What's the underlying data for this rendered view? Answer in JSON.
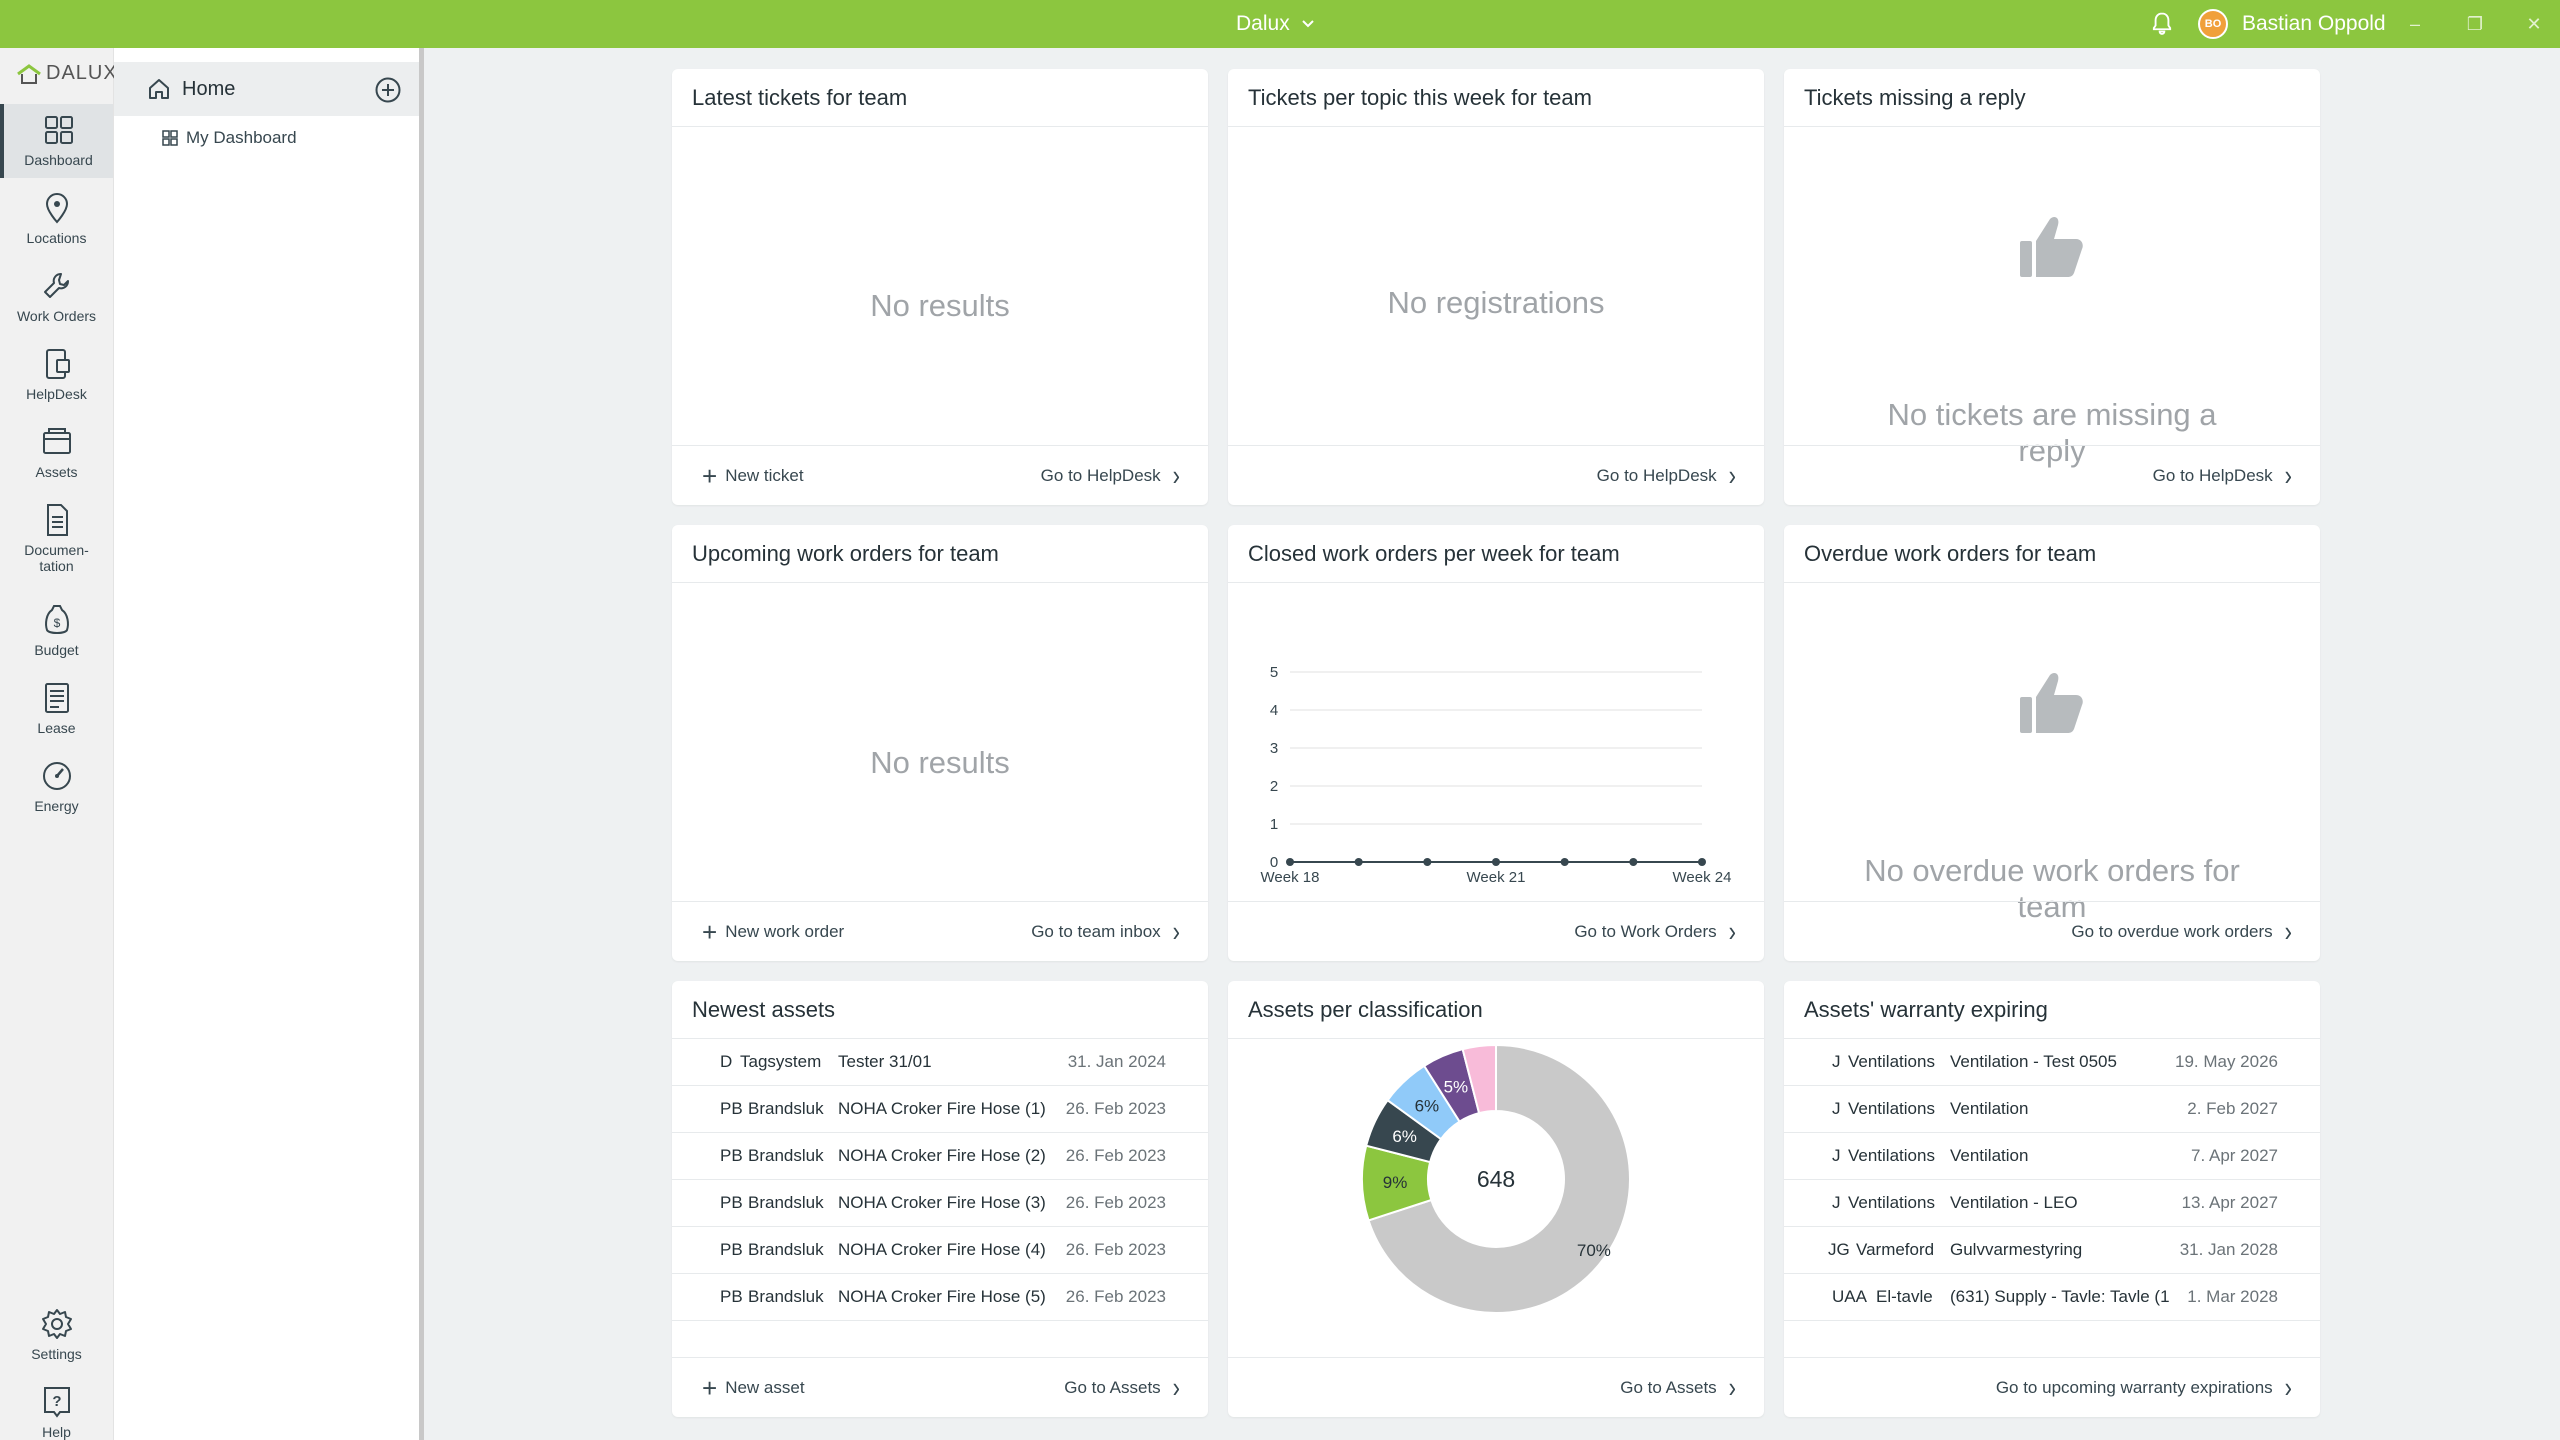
{
  "titlebar": {
    "app_title": "Dalux",
    "user_initials": "BO",
    "user_name": "Bastian Oppold"
  },
  "rail": {
    "logo_text": "DALUX",
    "items": [
      {
        "label": "Dashboard"
      },
      {
        "label": "Locations"
      },
      {
        "label": "Work Orders"
      },
      {
        "label": "HelpDesk"
      },
      {
        "label": "Assets"
      },
      {
        "label": "Documen-\ntation"
      },
      {
        "label": "Budget"
      },
      {
        "label": "Lease"
      },
      {
        "label": "Energy"
      },
      {
        "label": "Settings"
      },
      {
        "label": "Help"
      }
    ]
  },
  "nav": {
    "home_label": "Home",
    "dashboard_link": "My Dashboard"
  },
  "cards": {
    "latest_tickets": {
      "title": "Latest tickets for team",
      "empty": "No results",
      "new_label": "New ticket",
      "go_label": "Go to HelpDesk"
    },
    "tickets_topic": {
      "title": "Tickets per topic this week for team",
      "empty": "No registrations",
      "go_label": "Go to HelpDesk"
    },
    "missing_reply": {
      "title": "Tickets missing a reply",
      "empty_line1": "No tickets are missing a",
      "empty_line2": "reply",
      "go_label": "Go to HelpDesk"
    },
    "upcoming_wo": {
      "title": "Upcoming work orders for team",
      "empty": "No results",
      "new_label": "New work order",
      "go_label": "Go to team inbox"
    },
    "closed_wo": {
      "title": "Closed work orders per week for team",
      "go_label": "Go to Work Orders"
    },
    "overdue_wo": {
      "title": "Overdue work orders for team",
      "empty_line1": "No overdue work orders for",
      "empty_line2": "team",
      "go_label": "Go to overdue work orders"
    },
    "newest_assets": {
      "title": "Newest assets",
      "rows": [
        {
          "code": "D",
          "category": "Tagsystem",
          "name": "Tester 31/01",
          "date": "31. Jan 2024"
        },
        {
          "code": "PB",
          "category": "Brandsluk",
          "name": "NOHA Croker Fire Hose (1)",
          "date": "26. Feb 2023"
        },
        {
          "code": "PB",
          "category": "Brandsluk",
          "name": "NOHA Croker Fire Hose (2)",
          "date": "26. Feb 2023"
        },
        {
          "code": "PB",
          "category": "Brandsluk",
          "name": "NOHA Croker Fire Hose (3)",
          "date": "26. Feb 2023"
        },
        {
          "code": "PB",
          "category": "Brandsluk",
          "name": "NOHA Croker Fire Hose (4)",
          "date": "26. Feb 2023"
        },
        {
          "code": "PB",
          "category": "Brandsluk",
          "name": "NOHA Croker Fire Hose (5)",
          "date": "26. Feb 2023"
        }
      ],
      "new_label": "New asset",
      "go_label": "Go to Assets"
    },
    "assets_class": {
      "title": "Assets per classification",
      "go_label": "Go to Assets"
    },
    "warranty": {
      "title": "Assets' warranty expiring",
      "rows": [
        {
          "code": "J",
          "category": "Ventilations",
          "name": "Ventilation - Test 0505",
          "date": "19. May 2026"
        },
        {
          "code": "J",
          "category": "Ventilations",
          "name": "Ventilation",
          "date": "2. Feb 2027"
        },
        {
          "code": "J",
          "category": "Ventilations",
          "name": "Ventilation",
          "date": "7. Apr 2027"
        },
        {
          "code": "J",
          "category": "Ventilations",
          "name": "Ventilation - LEO",
          "date": "13. Apr 2027"
        },
        {
          "code": "JG",
          "category": "Varmeford",
          "name": "Gulvvarmestyring",
          "date": "31. Jan 2028"
        },
        {
          "code": "UAA",
          "category": "El-tavle",
          "name": "(631) Supply - Tavle: Tavle (1",
          "date": "1. Mar 2028"
        }
      ],
      "go_label": "Go to upcoming warranty expirations"
    }
  },
  "chart_data": [
    {
      "type": "line",
      "title": "Closed work orders per week for team",
      "x": [
        "Week 18",
        "Week 19",
        "Week 20",
        "Week 21",
        "Week 22",
        "Week 23",
        "Week 24"
      ],
      "x_tick_labels": [
        "Week 18",
        "Week 21",
        "Week 24"
      ],
      "series": [
        {
          "values": [
            0,
            0,
            0,
            0,
            0,
            0,
            0
          ],
          "color": "#37474f"
        }
      ],
      "ylim": [
        0,
        5
      ],
      "y_ticks": [
        0,
        1,
        2,
        3,
        4,
        5
      ],
      "grid": true
    },
    {
      "type": "pie",
      "title": "Assets per classification",
      "total_label": "648",
      "slices": [
        {
          "value": 70,
          "label": "70%",
          "color": "#c9c9c9"
        },
        {
          "value": 9,
          "label": "9%",
          "color": "#8cc63f"
        },
        {
          "value": 6,
          "label": "6%",
          "color": "#37474f"
        },
        {
          "value": 6,
          "label": "6%",
          "color": "#90caf9"
        },
        {
          "value": 5,
          "label": "5%",
          "color": "#6d4c8f"
        },
        {
          "value": 4,
          "label": "",
          "color": "#f8bbd9"
        }
      ]
    }
  ],
  "colors": {
    "brand_green": "#8cc63f",
    "dark": "#37474f",
    "background": "#eef1f2"
  }
}
